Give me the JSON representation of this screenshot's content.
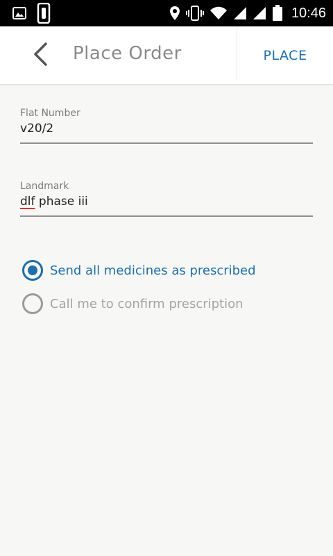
{
  "status_bar": {
    "time": "10:46",
    "icons": [
      "gallery-icon",
      "device-icon",
      "location-icon",
      "vibrate-icon",
      "wifi-icon",
      "signal-icon",
      "signal-icon",
      "battery-icon"
    ]
  },
  "app_bar": {
    "title": "Place Order",
    "action_label": "PLACE"
  },
  "form": {
    "flat_number": {
      "label": "Flat Number",
      "value": "v20/2"
    },
    "landmark": {
      "label": "Landmark",
      "value_misspelled": "dlf",
      "value_rest": " phase iii"
    }
  },
  "options": [
    {
      "label": "Send all medicines as prescribed",
      "selected": true
    },
    {
      "label": "Call me to confirm prescription",
      "selected": false
    }
  ],
  "colors": {
    "accent": "#1f6fa8",
    "status_bar": "#000000",
    "background": "#f7f7f5"
  }
}
